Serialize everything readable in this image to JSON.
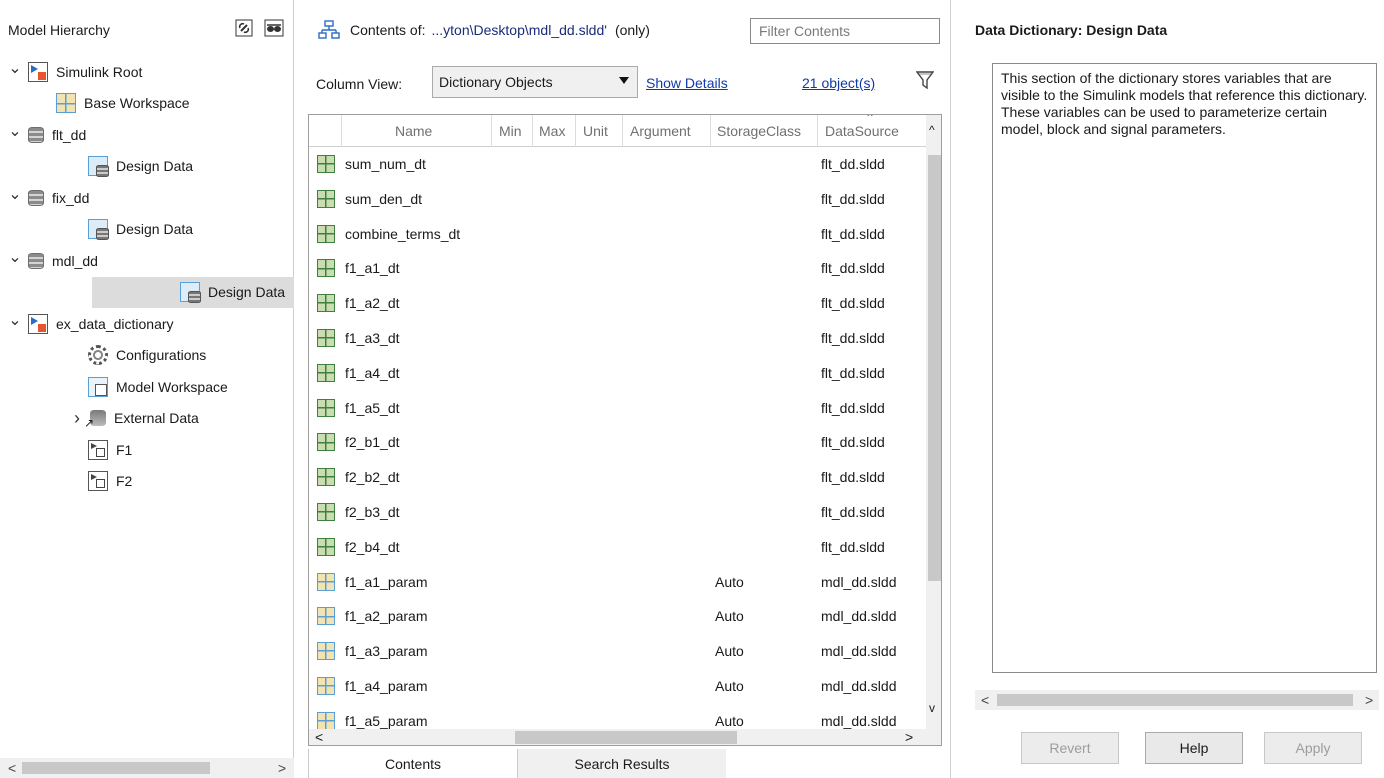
{
  "hierarchy": {
    "title": "Model Hierarchy",
    "tree": [
      {
        "label": "Simulink Root",
        "icon": "simulink-root-icon",
        "expanded": "chevron-down",
        "selected": false
      },
      {
        "label": "Base Workspace",
        "icon": "base-workspace-icon",
        "expanded": "",
        "selected": false
      },
      {
        "label": "flt_dd",
        "icon": "dictionary-icon",
        "expanded": "chevron-down",
        "selected": false
      },
      {
        "label": "Design Data",
        "icon": "design-data-icon",
        "expanded": "",
        "selected": false
      },
      {
        "label": "fix_dd",
        "icon": "dictionary-icon",
        "expanded": "chevron-down",
        "selected": false
      },
      {
        "label": "Design Data",
        "icon": "design-data-icon",
        "expanded": "",
        "selected": false
      },
      {
        "label": "mdl_dd",
        "icon": "dictionary-icon",
        "expanded": "chevron-down",
        "selected": false
      },
      {
        "label": "Design Data",
        "icon": "design-data-icon",
        "expanded": "",
        "selected": true
      },
      {
        "label": "ex_data_dictionary",
        "icon": "model-icon",
        "expanded": "chevron-down",
        "selected": false
      },
      {
        "label": "Configurations",
        "icon": "gear-icon",
        "expanded": "",
        "selected": false
      },
      {
        "label": "Model Workspace",
        "icon": "model-workspace-icon",
        "expanded": "",
        "selected": false
      },
      {
        "label": "External Data",
        "icon": "external-data-icon",
        "expanded": "chevron-right",
        "selected": false
      },
      {
        "label": "F1",
        "icon": "model-reference-icon",
        "expanded": "",
        "selected": false
      },
      {
        "label": "F2",
        "icon": "model-reference-icon",
        "expanded": "",
        "selected": false
      }
    ]
  },
  "contents": {
    "prefix": "Contents of:",
    "path": "...yton\\Desktop\\mdl_dd.sldd'",
    "scope": "(only)",
    "filter_placeholder": "Filter Contents",
    "column_view_label": "Column View:",
    "column_view_value": "Dictionary Objects",
    "show_details": "Show Details",
    "object_count": "21 object(s)",
    "columns": [
      "Name",
      "Min",
      "Max",
      "Unit",
      "Argument",
      "StorageClass",
      "DataSource"
    ],
    "rows": [
      {
        "name": "sum_num_dt",
        "storage": "",
        "source": "flt_dd.sldd",
        "kind": "sig"
      },
      {
        "name": "sum_den_dt",
        "storage": "",
        "source": "flt_dd.sldd",
        "kind": "sig"
      },
      {
        "name": "combine_terms_dt",
        "storage": "",
        "source": "flt_dd.sldd",
        "kind": "sig"
      },
      {
        "name": "f1_a1_dt",
        "storage": "",
        "source": "flt_dd.sldd",
        "kind": "sig"
      },
      {
        "name": "f1_a2_dt",
        "storage": "",
        "source": "flt_dd.sldd",
        "kind": "sig"
      },
      {
        "name": "f1_a3_dt",
        "storage": "",
        "source": "flt_dd.sldd",
        "kind": "sig"
      },
      {
        "name": "f1_a4_dt",
        "storage": "",
        "source": "flt_dd.sldd",
        "kind": "sig"
      },
      {
        "name": "f1_a5_dt",
        "storage": "",
        "source": "flt_dd.sldd",
        "kind": "sig"
      },
      {
        "name": "f2_b1_dt",
        "storage": "",
        "source": "flt_dd.sldd",
        "kind": "sig"
      },
      {
        "name": "f2_b2_dt",
        "storage": "",
        "source": "flt_dd.sldd",
        "kind": "sig"
      },
      {
        "name": "f2_b3_dt",
        "storage": "",
        "source": "flt_dd.sldd",
        "kind": "sig"
      },
      {
        "name": "f2_b4_dt",
        "storage": "",
        "source": "flt_dd.sldd",
        "kind": "sig"
      },
      {
        "name": "f1_a1_param",
        "storage": "Auto",
        "source": "mdl_dd.sldd",
        "kind": "prm"
      },
      {
        "name": "f1_a2_param",
        "storage": "Auto",
        "source": "mdl_dd.sldd",
        "kind": "prm"
      },
      {
        "name": "f1_a3_param",
        "storage": "Auto",
        "source": "mdl_dd.sldd",
        "kind": "prm"
      },
      {
        "name": "f1_a4_param",
        "storage": "Auto",
        "source": "mdl_dd.sldd",
        "kind": "prm"
      },
      {
        "name": "f1_a5_param",
        "storage": "Auto",
        "source": "mdl_dd.sldd",
        "kind": "prm"
      }
    ],
    "tabs": [
      "Contents",
      "Search Results"
    ]
  },
  "details": {
    "title": "Data Dictionary: Design Data",
    "description": "This section of the dictionary stores variables that are visible to the Simulink models that reference this dictionary. These variables can be used to parameterize certain model, block and signal parameters.",
    "buttons": {
      "revert": "Revert",
      "help": "Help",
      "apply": "Apply"
    }
  }
}
